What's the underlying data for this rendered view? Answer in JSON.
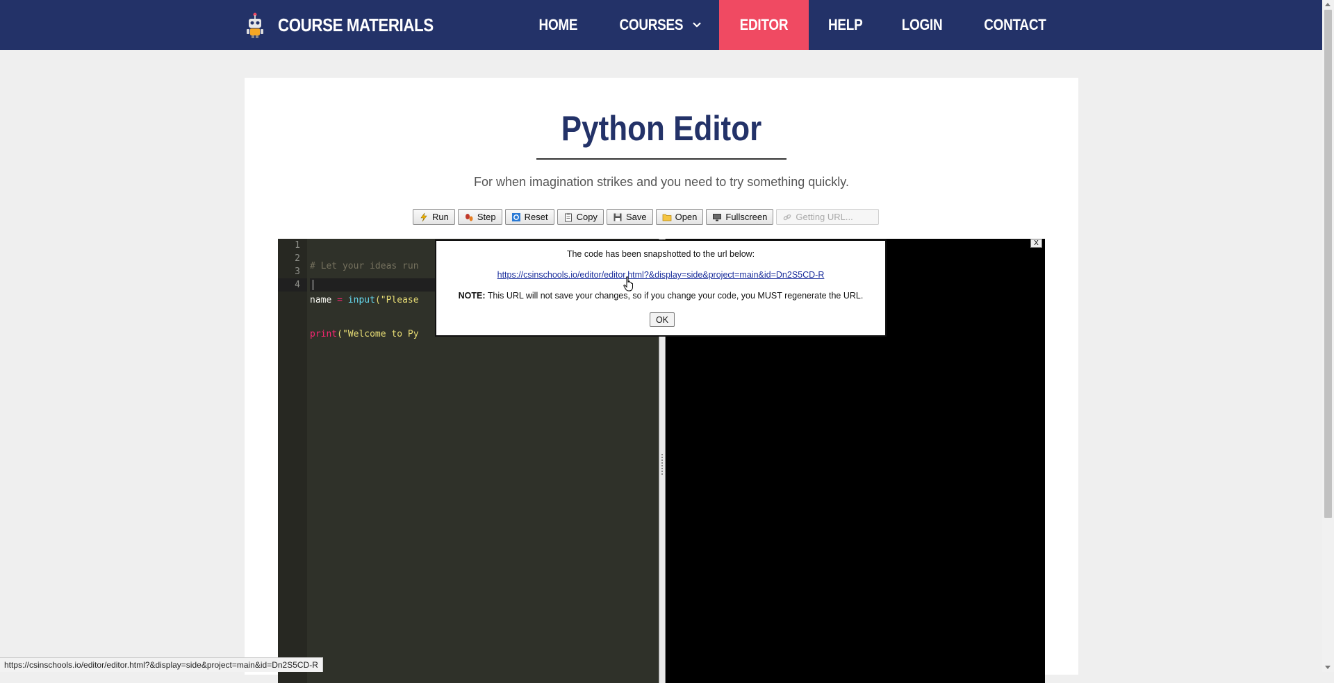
{
  "brand": {
    "name": "COURSE MATERIALS",
    "logo": "robot-logo-icon"
  },
  "nav": {
    "items": [
      {
        "label": "HOME"
      },
      {
        "label": "COURSES"
      },
      {
        "label": "EDITOR"
      },
      {
        "label": "HELP"
      },
      {
        "label": "LOGIN"
      },
      {
        "label": "CONTACT"
      }
    ],
    "active": "EDITOR"
  },
  "page": {
    "title": "Python Editor",
    "subtitle": "For when imagination strikes and you need to try something quickly."
  },
  "toolbar": {
    "run": "Run",
    "step": "Step",
    "reset": "Reset",
    "copy": "Copy",
    "save": "Save",
    "open": "Open",
    "fullscreen": "Fullscreen",
    "geturl": "Getting URL..."
  },
  "editor": {
    "line_numbers": [
      "1",
      "2",
      "3",
      "4"
    ],
    "lines": {
      "l1_comment": "# Let your ideas run",
      "l2_var": "name ",
      "l2_op": "=",
      "l2_fn": "input",
      "l2_rest": "(\"Please",
      "l3_fn": "print",
      "l3_rest": "(\"Welcome to Py"
    }
  },
  "output": {
    "close_label": "X"
  },
  "dialog": {
    "message": "The code has been snapshotted to the url below:",
    "url": "https://csinschools.io/editor/editor.html?&display=side&project=main&id=Dn2S5CD-R",
    "note_label": "NOTE:",
    "note_text": " This URL will not save your changes, so if you change your code, you MUST regenerate the URL.",
    "ok_label": "OK"
  },
  "status": {
    "text": "https://csinschools.io/editor/editor.html?&display=side&project=main&id=Dn2S5CD-R"
  },
  "colors": {
    "nav_bg": "#233268",
    "active": "#f04a62",
    "title": "#233268"
  }
}
